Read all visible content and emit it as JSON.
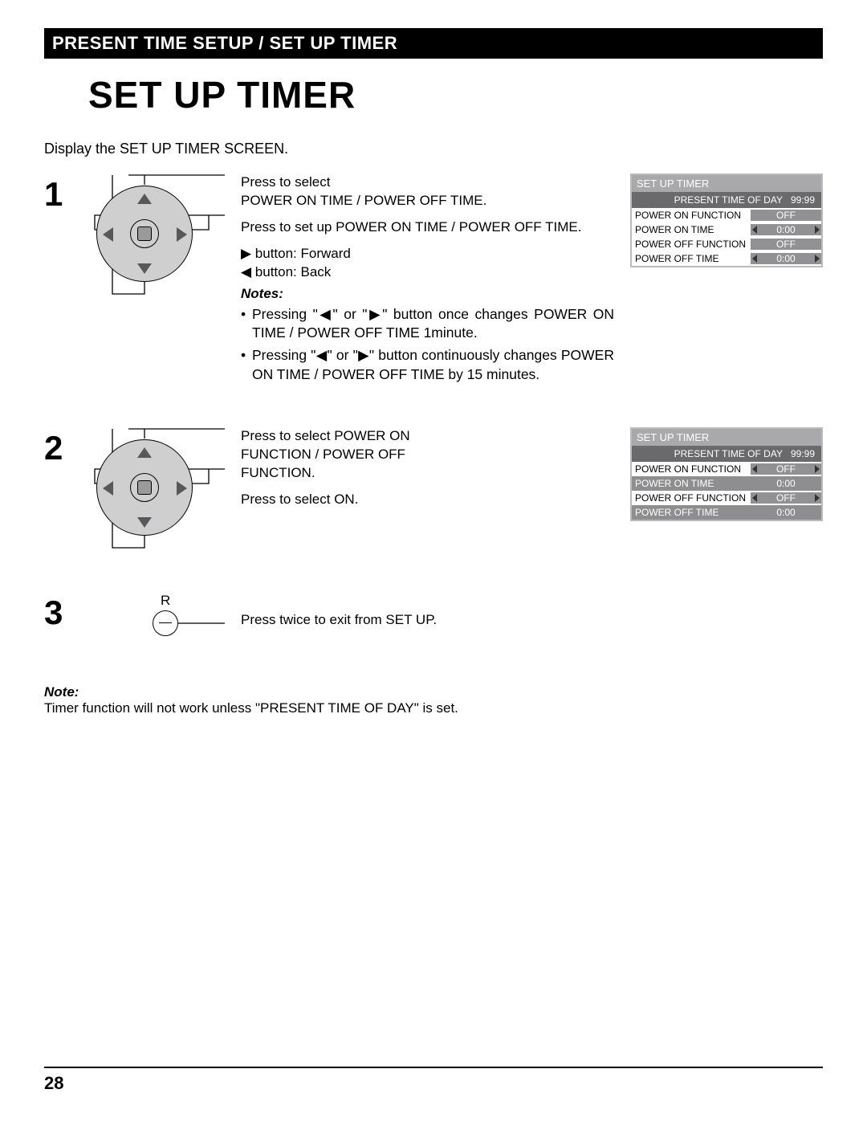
{
  "header": {
    "band": "PRESENT TIME SETUP / SET UP TIMER",
    "title": "SET UP TIMER"
  },
  "intro": "Display the SET UP TIMER SCREEN.",
  "steps": {
    "s1": {
      "num": "1",
      "line1": "Press to select",
      "line2": "POWER ON TIME / POWER OFF TIME.",
      "line3": "Press to set up POWER ON TIME / POWER OFF TIME.",
      "fwd": "▶ button: Forward",
      "back": "◀ button: Back",
      "notes_label": "Notes:",
      "note1": "Pressing \"◀\" or \"▶\" button once changes POWER ON TIME / POWER OFF TIME 1minute.",
      "note2": "Pressing \"◀\" or \"▶\" button continuously changes POWER ON TIME / POWER OFF TIME by 15 minutes."
    },
    "s2": {
      "num": "2",
      "line1": "Press to select POWER ON FUNCTION / POWER OFF FUNCTION.",
      "line2": "Press to select ON."
    },
    "s3": {
      "num": "3",
      "r_label": "R",
      "line1": "Press twice to exit from SET UP."
    }
  },
  "osd1": {
    "title": "SET UP TIMER",
    "sub_label": "PRESENT  TIME OF DAY",
    "sub_val": "99:99",
    "rows": [
      {
        "label": "POWER ON FUNCTION",
        "val": "OFF",
        "arrows": false,
        "hi": true
      },
      {
        "label": "POWER ON TIME",
        "val": "0:00",
        "arrows": true,
        "hi": true
      },
      {
        "label": "POWER OFF FUNCTION",
        "val": "OFF",
        "arrows": false,
        "hi": true
      },
      {
        "label": "POWER OFF TIME",
        "val": "0:00",
        "arrows": true,
        "hi": true
      }
    ]
  },
  "osd2": {
    "title": "SET UP TIMER",
    "sub_label": "PRESENT  TIME OF DAY",
    "sub_val": "99:99",
    "rows": [
      {
        "label": "POWER ON FUNCTION",
        "val": "OFF",
        "arrows": true,
        "hi": true
      },
      {
        "label": "POWER ON TIME",
        "val": "0:00",
        "arrows": false,
        "hi": false
      },
      {
        "label": "POWER OFF FUNCTION",
        "val": "OFF",
        "arrows": true,
        "hi": true
      },
      {
        "label": "POWER OFF TIME",
        "val": "0:00",
        "arrows": false,
        "hi": false
      }
    ]
  },
  "footer_note": {
    "label": "Note:",
    "text": "Timer function will not work unless \"PRESENT TIME OF DAY\" is set."
  },
  "page_number": "28"
}
